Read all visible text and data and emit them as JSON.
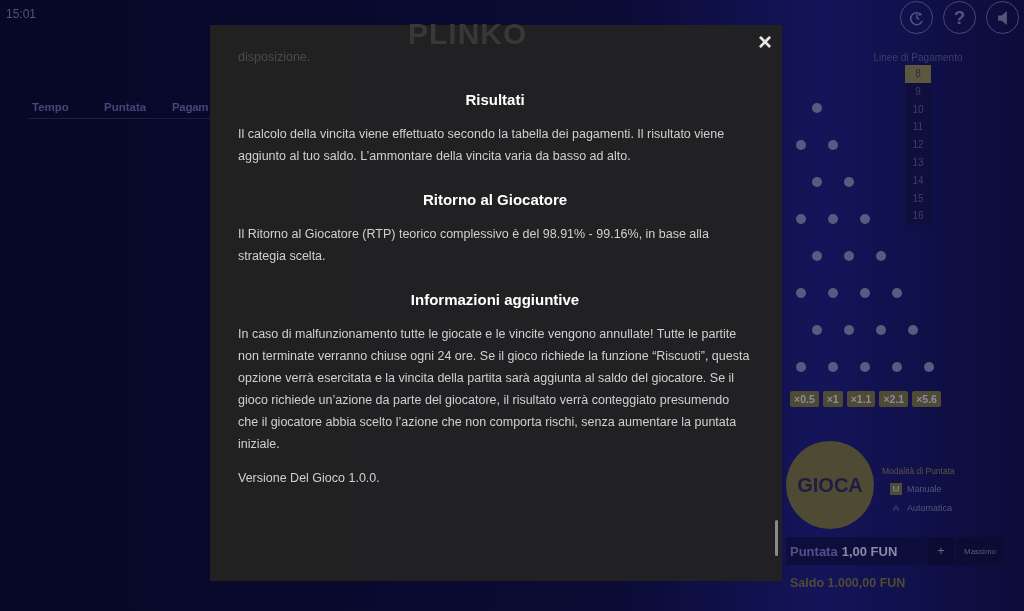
{
  "clock": "15:01",
  "logo": {
    "text": "PLINKO"
  },
  "history_table": {
    "columns": [
      "Tempo",
      "Puntata",
      "Pagam"
    ]
  },
  "top_buttons": [
    {
      "kind": "history"
    },
    {
      "kind": "help",
      "symbol": "?"
    },
    {
      "kind": "sound"
    }
  ],
  "paylines": {
    "title": "Linee di Pagamento",
    "items": [
      {
        "label": "8",
        "selected": true
      },
      {
        "label": "9",
        "selected": false
      },
      {
        "label": "10",
        "selected": false
      },
      {
        "label": "11",
        "selected": false
      },
      {
        "label": "12",
        "selected": false
      },
      {
        "label": "13",
        "selected": false
      },
      {
        "label": "14",
        "selected": false
      },
      {
        "label": "15",
        "selected": false
      },
      {
        "label": "16",
        "selected": false
      }
    ]
  },
  "multipliers": [
    "×0.5",
    "×1",
    "×1.1",
    "×2.1",
    "×5.6"
  ],
  "play_button": "GIOCA",
  "bet_mode": {
    "title": "Modalità di Puntata",
    "options": [
      {
        "key": "M",
        "label": "Manuale",
        "selected": true
      },
      {
        "key": "A",
        "label": "Automatica",
        "selected": false
      }
    ]
  },
  "bet": {
    "label": "Puntata",
    "value": "1,00 FUN",
    "plus": "+",
    "max": "Massimo"
  },
  "balance": "Saldo 1.000,00 FUN",
  "modal": {
    "close": "×",
    "faded_text": "disposizione.",
    "sections": [
      {
        "heading": "Risultati",
        "paragraphs": [
          "Il calcolo della vincita viene effettuato secondo la tabella dei pagamenti. Il risultato viene aggiunto al tuo saldo. L’ammontare della vincita varia da basso ad alto."
        ]
      },
      {
        "heading": "Ritorno al Giocatore",
        "paragraphs": [
          "Il Ritorno al Giocatore (RTP) teorico complessivo è del 98.91% - 99.16%, in base alla strategia scelta."
        ]
      },
      {
        "heading": "Informazioni aggiuntive",
        "paragraphs": [
          "In caso di malfunzionamento tutte le giocate e le vincite vengono annullate! Tutte le partite non terminate verranno chiuse ogni 24 ore. Se il gioco richiede la funzione “Riscuoti”, questa opzione verrà esercitata e la vincita della partita sarà aggiunta al saldo del giocatore. Se il gioco richiede un’azione da parte del giocatore, il risultato verrà conteggiato presumendo che il giocatore abbia scelto l’azione che non comporta rischi, senza aumentare la puntata iniziale.",
          "Versione Del Gioco 1.0.0."
        ]
      }
    ]
  }
}
